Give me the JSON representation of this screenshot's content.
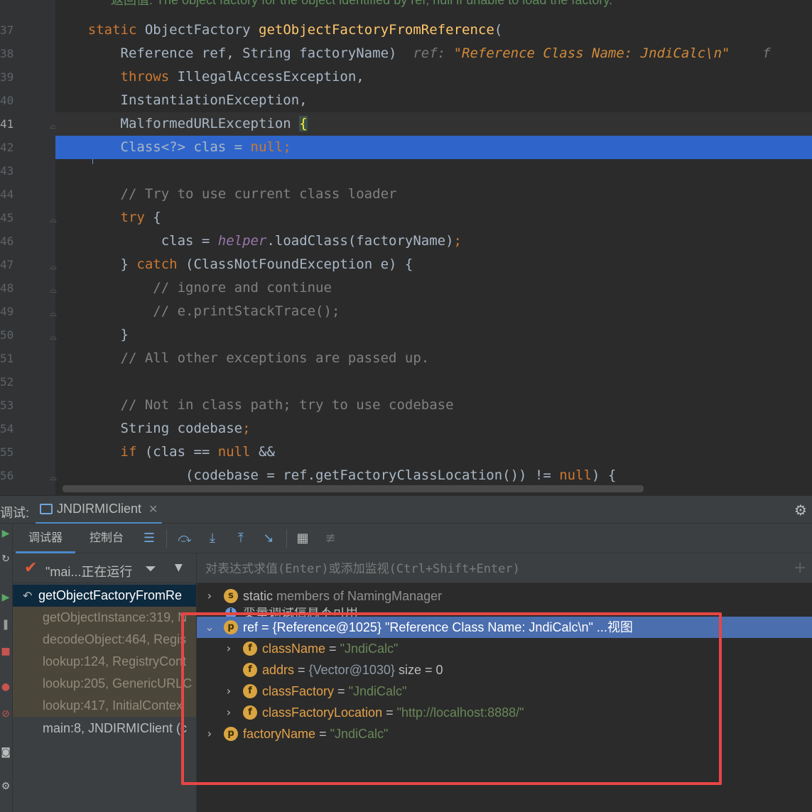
{
  "editor": {
    "doc_comment": "返回值: The object factory for the object identified by ref; null if unable to load the factory.",
    "doc_right": "...",
    "line_numbers": [
      "37",
      "38",
      "39",
      "40",
      "41",
      "42",
      "43",
      "44",
      "45",
      "46",
      "47",
      "48",
      "49",
      "50",
      "51",
      "52",
      "53",
      "54",
      "55",
      "56"
    ],
    "lines": {
      "l37": {
        "kw": "static",
        "type": "ObjectFactory",
        "fn": "getObjectFactoryFromReference",
        "punct": "("
      },
      "l38": {
        "code": "Reference ref, String factoryName)",
        "hint_label": "ref:",
        "hint_value": "\"Reference Class Name: JndiCalc\\n\"",
        "hint_tail": "f"
      },
      "l39": {
        "kw": "throws",
        "code": "IllegalAccessException,"
      },
      "l40": {
        "code": "InstantiationException,"
      },
      "l41": {
        "code": "MalformedURLException",
        "brace": "{"
      },
      "l42": {
        "code": "Class<?> clas = ",
        "kw": "null",
        "punct": ";"
      },
      "l44": {
        "comment": "// Try to use current class loader"
      },
      "l45": {
        "kw": "try",
        "code": " {"
      },
      "l46": {
        "pre": "clas = ",
        "italic": "helper",
        "post": ".loadClass(factoryName)",
        "punct": ";"
      },
      "l47": {
        "pre": "} ",
        "kw": "catch",
        "code": " (ClassNotFoundException e) {"
      },
      "l48": {
        "comment": "// ignore and continue"
      },
      "l49": {
        "comment": "// e.printStackTrace();"
      },
      "l50": {
        "code": "}"
      },
      "l51": {
        "comment": "// All other exceptions are passed up."
      },
      "l53": {
        "comment": "// Not in class path; try to use codebase"
      },
      "l54": {
        "code": "String codebase",
        "punct": ";"
      },
      "l55": {
        "kw": "if",
        "pre": " (clas == ",
        "kw2": "null",
        "post": " &&"
      },
      "l56": {
        "pre": "(codebase = ref.getFactoryClassLocation()) != ",
        "kw": "null",
        "post": ") {"
      }
    }
  },
  "debug": {
    "panel_title": "调试:",
    "session_tab": "JNDIRMIClient",
    "tabs": {
      "debugger": "调试器",
      "console": "控制台"
    },
    "thread": "\"mai...正在运行",
    "frames": [
      {
        "label": "getObjectFactoryFromRe",
        "kind": "sel"
      },
      {
        "label": "getObjectInstance:319, N",
        "kind": "lib"
      },
      {
        "label": "decodeObject:464, Regis",
        "kind": "lib"
      },
      {
        "label": "lookup:124, RegistryCont",
        "kind": "lib"
      },
      {
        "label": "lookup:205, GenericURLC",
        "kind": "lib"
      },
      {
        "label": "lookup:417, InitialContex",
        "kind": "lib"
      },
      {
        "label": "main:8, JNDIRMIClient (c",
        "kind": "normal"
      }
    ],
    "eval_placeholder": "对表达式求值(Enter)或添加监视(Ctrl+Shift+Enter)",
    "vars": {
      "static_row": {
        "kw": "static",
        "text": "members of NamingManager"
      },
      "info_row": "变量调试信息不可用",
      "ref": {
        "name": "ref",
        "value": "{Reference@1025}",
        "str": "\"Reference Class Name: JndiCalc\\n\"",
        "link": "...视图"
      },
      "className": {
        "name": "className",
        "value": "\"JndiCalc\""
      },
      "addrs": {
        "name": "addrs",
        "value": "{Vector@1030}",
        "extra": "size = 0"
      },
      "classFactory": {
        "name": "classFactory",
        "value": "\"JndiCalc\""
      },
      "classFactoryLocation": {
        "name": "classFactoryLocation",
        "value": "\"http://localhost:8888/\""
      },
      "factoryName": {
        "name": "factoryName",
        "value": "\"JndiCalc\""
      }
    },
    "badges": {
      "s": "s",
      "p": "p",
      "f": "f",
      "i": "i"
    },
    "eq": "="
  },
  "colors": {
    "accent": "#4a88c7",
    "selection": "#2f65ca",
    "highlight_box": "#e84545"
  }
}
